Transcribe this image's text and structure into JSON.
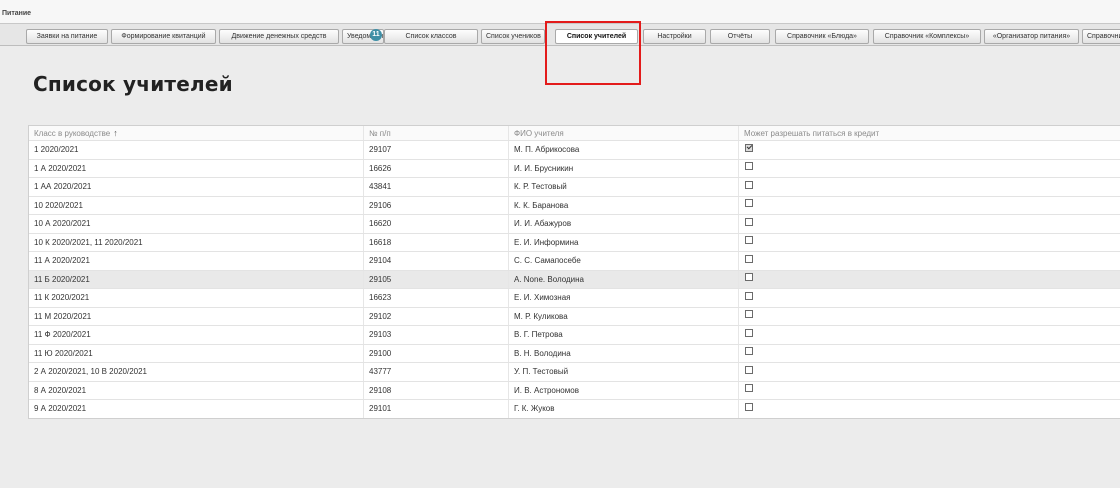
{
  "section": {
    "title": "Питание"
  },
  "tabs": [
    {
      "label": "Заявки на питание"
    },
    {
      "label": "Формирование квитанций"
    },
    {
      "label": "Движение денежных средств"
    },
    {
      "label": "Уведомления"
    },
    {
      "label": "Список классов"
    },
    {
      "label": "Список учеников"
    },
    {
      "label": "Список учителей",
      "active": true
    },
    {
      "label": "Настройки"
    },
    {
      "label": "Отчёты"
    },
    {
      "label": "Справочник «Блюда»"
    },
    {
      "label": "Справочник «Комплексы»"
    },
    {
      "label": "«Организатор питания»"
    },
    {
      "label": "Справочники"
    }
  ],
  "notifications_badge": "11",
  "highlight_color": "#e31b1b",
  "page_title": "Список учителей",
  "table": {
    "columns": [
      "Класс в руководстве",
      "№ п/п",
      "ФИО учителя",
      "Может разрешать питаться в кредит"
    ],
    "sort_indicator": "↑",
    "rows": [
      {
        "class": "1 2020/2021",
        "num": "29107",
        "teacher": "М. П. Абрикосова",
        "credit": true
      },
      {
        "class": "1 А 2020/2021",
        "num": "16626",
        "teacher": "И. И. Брусникин",
        "credit": false
      },
      {
        "class": "1 АА 2020/2021",
        "num": "43841",
        "teacher": "К. Р. Тестовый",
        "credit": false
      },
      {
        "class": "10 2020/2021",
        "num": "29106",
        "teacher": "К. К. Баранова",
        "credit": false
      },
      {
        "class": "10 А 2020/2021",
        "num": "16620",
        "teacher": "И. И. Абажуров",
        "credit": false
      },
      {
        "class": "10 К 2020/2021, 11 2020/2021",
        "num": "16618",
        "teacher": "Е. И. Информина",
        "credit": false
      },
      {
        "class": "11 А 2020/2021",
        "num": "29104",
        "teacher": "С. С. Самапосебе",
        "credit": false
      },
      {
        "class": "11 Б 2020/2021",
        "num": "29105",
        "teacher": "А. None. Володина",
        "credit": false,
        "selected": true
      },
      {
        "class": "11 К 2020/2021",
        "num": "16623",
        "teacher": "Е. И. Химозная",
        "credit": false
      },
      {
        "class": "11 М 2020/2021",
        "num": "29102",
        "teacher": "М. Р. Куликова",
        "credit": false
      },
      {
        "class": "11 Ф 2020/2021",
        "num": "29103",
        "teacher": "В. Г. Петрова",
        "credit": false
      },
      {
        "class": "11 Ю 2020/2021",
        "num": "29100",
        "teacher": "В. Н. Володина",
        "credit": false
      },
      {
        "class": "2 А 2020/2021, 10 В 2020/2021",
        "num": "43777",
        "teacher": "У. П. Тестовый",
        "credit": false
      },
      {
        "class": "8 А 2020/2021",
        "num": "29108",
        "teacher": "И. В. Астрономов",
        "credit": false
      },
      {
        "class": "9 А 2020/2021",
        "num": "29101",
        "teacher": "Г. К. Жуков",
        "credit": false
      }
    ]
  }
}
